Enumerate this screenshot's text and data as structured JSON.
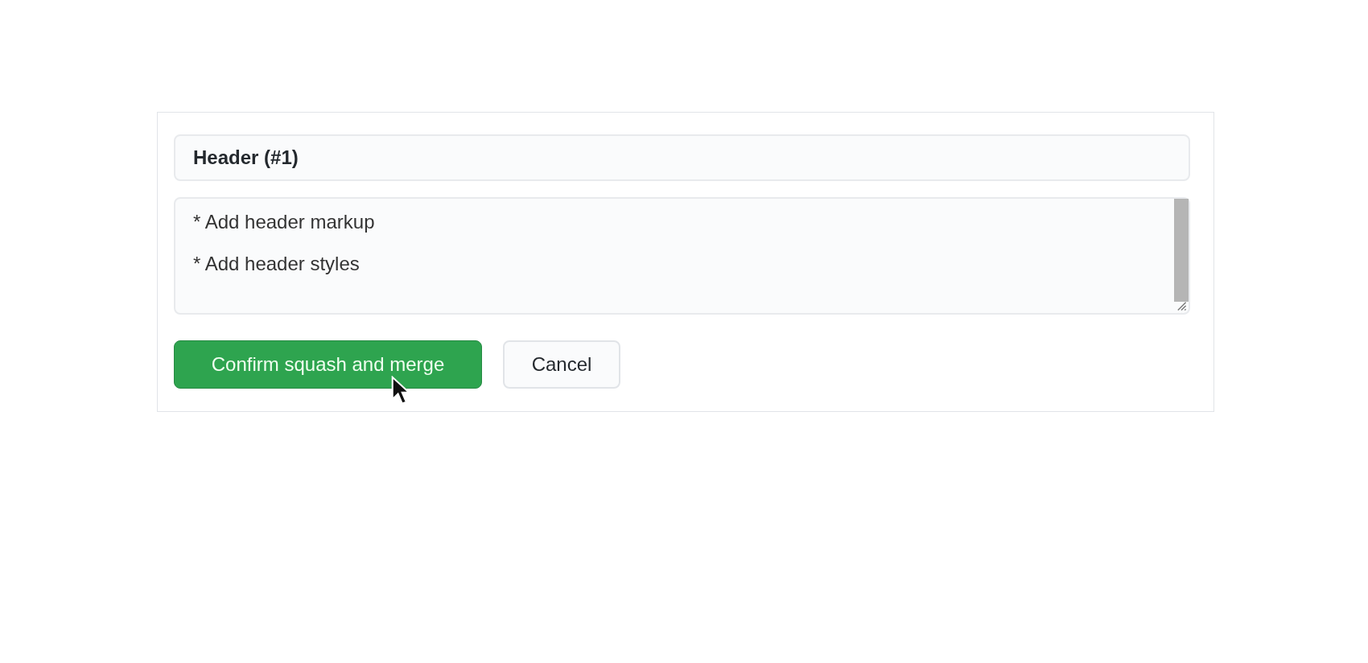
{
  "merge_form": {
    "title_field": {
      "value": "Header (#1)"
    },
    "message_field": {
      "value": "* Add header markup\n\n* Add header styles"
    },
    "buttons": [
      {
        "label": "Confirm squash and merge",
        "kind": "primary"
      },
      {
        "label": "Cancel",
        "kind": "secondary"
      }
    ]
  }
}
